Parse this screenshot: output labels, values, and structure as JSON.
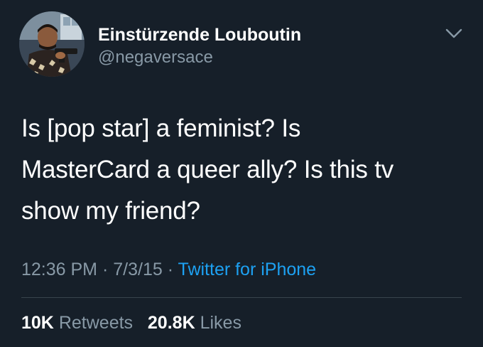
{
  "user": {
    "display_name": "Einstürzende Louboutin",
    "handle": "@negaversace",
    "avatar_icon": "profile-photo"
  },
  "tweet": {
    "text_lines": [
      "Is [pop star] a feminist? Is",
      "MasterCard a queer ally? Is this tv",
      "show my friend?"
    ]
  },
  "meta": {
    "time": "12:36 PM",
    "separator": "·",
    "date": "7/3/15",
    "source": "Twitter for iPhone"
  },
  "stats": {
    "retweets_count": "10K",
    "retweets_label": "Retweets",
    "likes_count": "20.8K",
    "likes_label": "Likes"
  },
  "colors": {
    "background": "#161f29",
    "text": "#ffffff",
    "secondary": "#8899a6",
    "link": "#1da1f2",
    "divider": "#38444d"
  },
  "icons": {
    "menu": "chevron-down-icon"
  }
}
